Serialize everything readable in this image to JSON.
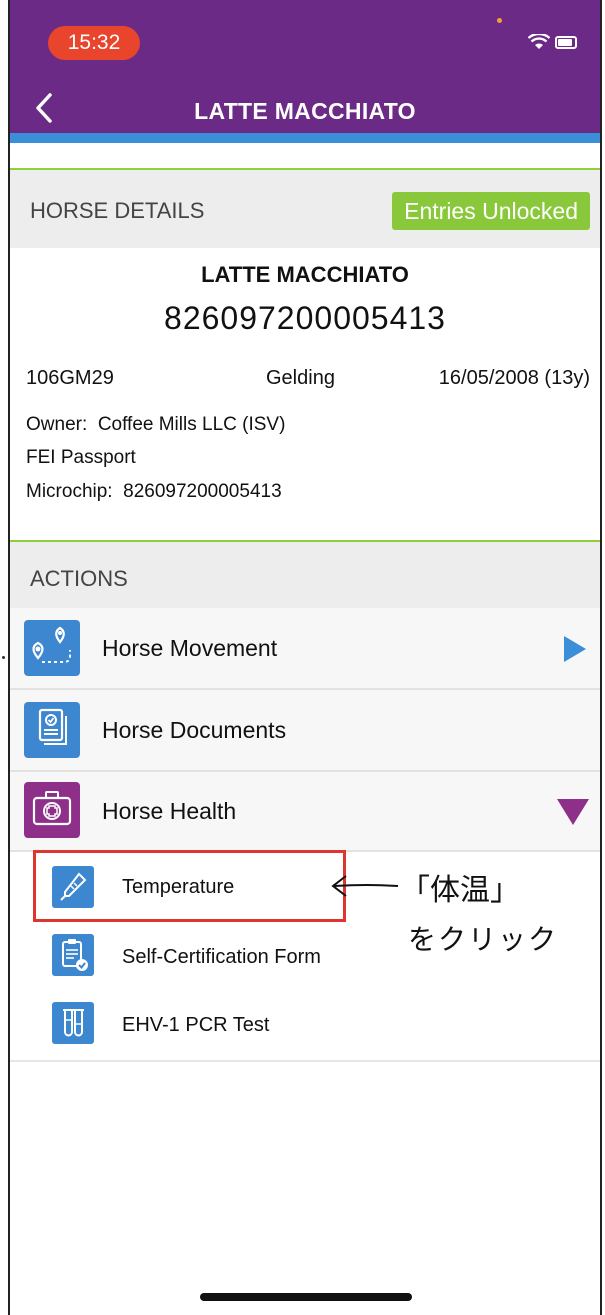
{
  "status_bar": {
    "time": "15:32"
  },
  "header": {
    "title": "LATTE MACCHIATO",
    "back_icon": "chevron-left-icon"
  },
  "horse_details": {
    "section_label": "HORSE DETAILS",
    "badge": "Entries Unlocked",
    "name": "LATTE MACCHIATO",
    "chip_number": "826097200005413",
    "id": "106GM29",
    "sex": "Gelding",
    "dob": "16/05/2008 (13y)",
    "owner_label": "Owner:",
    "owner": "Coffee Mills LLC (ISV)",
    "passport": "FEI Passport",
    "microchip_label": "Microchip:",
    "microchip": "826097200005413"
  },
  "actions": {
    "section_label": "ACTIONS",
    "items": [
      {
        "label": "Horse Movement",
        "icon": "location-route-icon",
        "indicator": "play-right-icon"
      },
      {
        "label": "Horse Documents",
        "icon": "documents-check-icon"
      },
      {
        "label": "Horse Health",
        "icon": "first-aid-kit-icon",
        "indicator": "triangle-down-icon"
      }
    ],
    "health_sub_items": [
      {
        "label": "Temperature",
        "icon": "thermometer-icon"
      },
      {
        "label": "Self-Certification Form",
        "icon": "clipboard-check-icon"
      },
      {
        "label": "EHV-1 PCR Test",
        "icon": "test-tubes-icon"
      }
    ]
  },
  "annotation": {
    "line1": "「体温」",
    "line2": "をクリック"
  },
  "colors": {
    "header": "#6b2a85",
    "badge": "#8ac83b",
    "icon_blue": "#3d86d0",
    "health_purple": "#8e2f8a",
    "highlight_red": "#e0352f"
  }
}
